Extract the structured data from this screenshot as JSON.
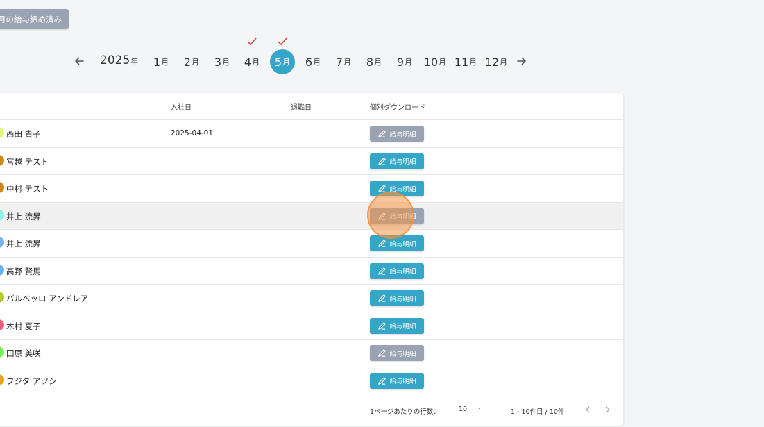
{
  "top_button": {
    "label": "月の給与締め済み"
  },
  "month_nav": {
    "year": "2025",
    "year_unit": "年",
    "month_unit": "月",
    "months": [
      "1",
      "2",
      "3",
      "4",
      "5",
      "6",
      "7",
      "8",
      "9",
      "10",
      "11",
      "12"
    ],
    "active_month": "5",
    "checked_months": [
      "4",
      "5"
    ]
  },
  "colors": {
    "accent": "#35a6c7",
    "disabled_button": "#9aa3b2",
    "check": "#d9453a"
  },
  "table": {
    "headers": {
      "hire_date": "入社日",
      "leave_date": "退職日",
      "download": "個別ダウンロード"
    },
    "download_label": "給与明細",
    "rows": [
      {
        "name": "西田 貴子",
        "hire_date": "2025-04-01",
        "avatar_color": "#e3f77a",
        "button_state": "disabled"
      },
      {
        "name": "宮越 テスト",
        "hire_date": "",
        "avatar_color": "#c98a18",
        "button_state": "active"
      },
      {
        "name": "中村 テスト",
        "hire_date": "",
        "avatar_color": "#c98a18",
        "button_state": "active"
      },
      {
        "name": "井上 流昇",
        "hire_date": "",
        "avatar_color": "#8ff0e4",
        "button_state": "disabled"
      },
      {
        "name": "井上 流昇",
        "hire_date": "",
        "avatar_color": "#7ab2ee",
        "button_state": "active"
      },
      {
        "name": "高野 賢馬",
        "hire_date": "",
        "avatar_color": "#6ab0f0",
        "button_state": "active"
      },
      {
        "name": "バルベッロ アンドレア",
        "hire_date": "",
        "avatar_color": "#b6c92a",
        "button_state": "active"
      },
      {
        "name": "木村 夏子",
        "hire_date": "",
        "avatar_color": "#ef5d78",
        "button_state": "active"
      },
      {
        "name": "田原 美咲",
        "hire_date": "",
        "avatar_color": "#7cf05a",
        "button_state": "disabled"
      },
      {
        "name": "フジタ アツシ",
        "hire_date": "",
        "avatar_color": "#e7a21c",
        "button_state": "active"
      }
    ]
  },
  "pagination": {
    "rows_per_page_label": "1ページあたりの行数：",
    "rows_per_page": "10",
    "range_text": "1 - 10件目 / 10件"
  }
}
